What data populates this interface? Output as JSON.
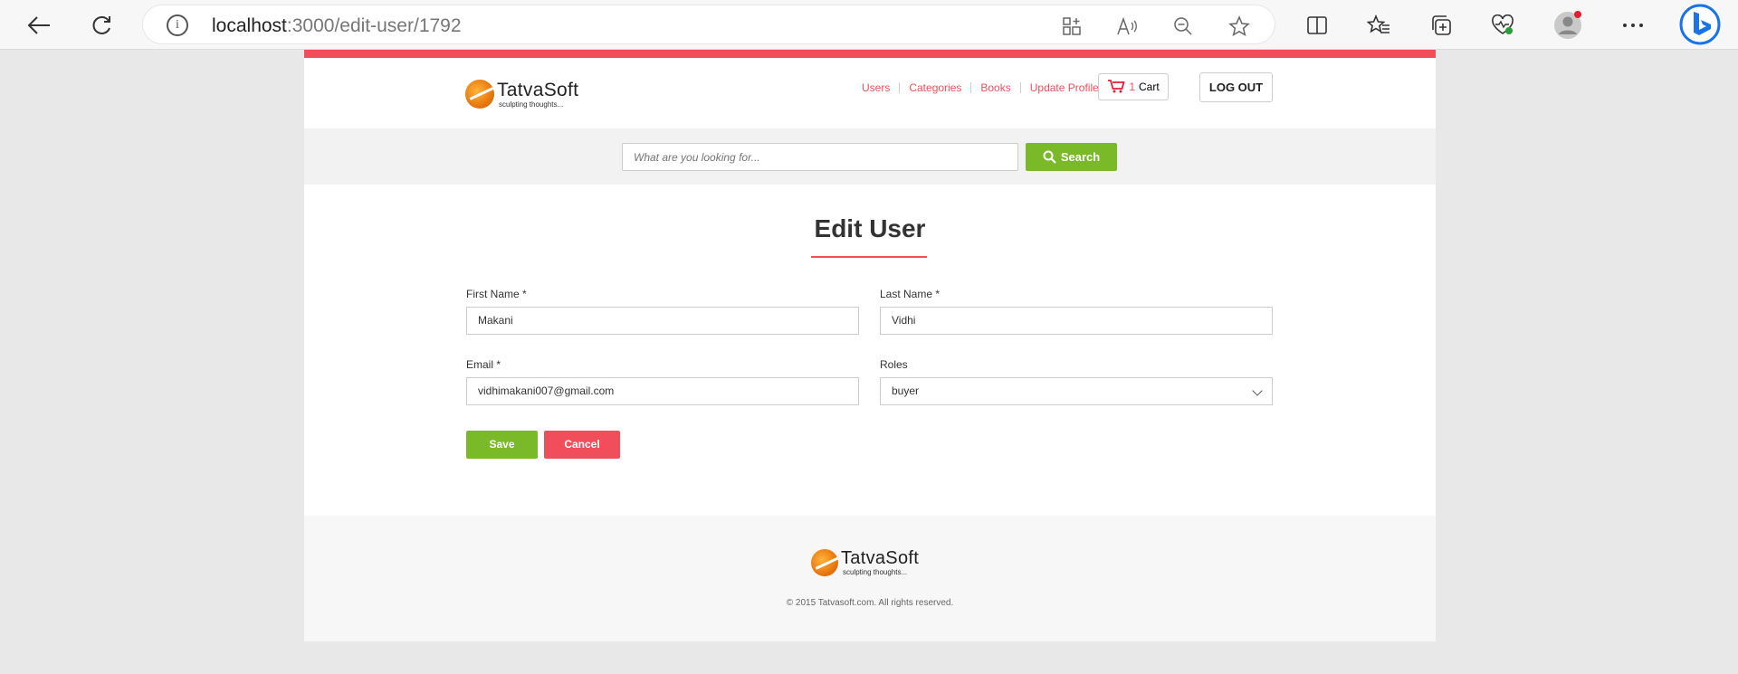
{
  "browser": {
    "url_host": "localhost",
    "url_path": ":3000/edit-user/1792"
  },
  "header": {
    "logo_name": "TatvaSoft",
    "logo_tagline": "sculpting thoughts...",
    "nav": [
      "Users",
      "Categories",
      "Books",
      "Update Profile"
    ],
    "cart_count": "1",
    "cart_label": "Cart",
    "logout_label": "LOG OUT"
  },
  "search": {
    "placeholder": "What are you looking for...",
    "button_label": "Search"
  },
  "form": {
    "title": "Edit User",
    "first_name_label": "First Name *",
    "first_name_value": "Makani",
    "last_name_label": "Last Name *",
    "last_name_value": "Vidhi",
    "email_label": "Email *",
    "email_value": "vidhimakani007@gmail.com",
    "roles_label": "Roles",
    "roles_value": "buyer",
    "save_label": "Save",
    "cancel_label": "Cancel"
  },
  "footer": {
    "logo_name": "TatvaSoft",
    "logo_tagline": "sculpting thoughts...",
    "copyright": "© 2015 Tatvasoft.com. All rights reserved."
  },
  "colors": {
    "accent_red": "#f14e5c",
    "accent_green": "#7ab928"
  }
}
